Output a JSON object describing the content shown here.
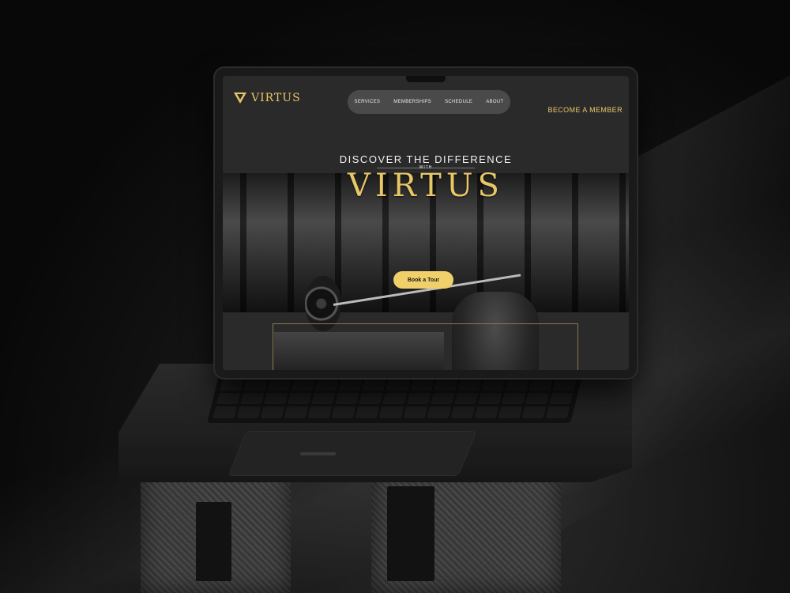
{
  "site": {
    "brand": "VIRTUS",
    "nav": {
      "items": [
        {
          "label": "SERVICES"
        },
        {
          "label": "MEMBERSHIPS"
        },
        {
          "label": "SCHEDULE"
        },
        {
          "label": "ABOUT"
        }
      ]
    },
    "cta_top": "BECOME A MEMBER",
    "hero": {
      "heading": "DISCOVER THE DIFFERENCE",
      "with": "WITH",
      "brand_big": "VIRTUS",
      "button": "Book a Tour"
    }
  },
  "colors": {
    "accent": "#e8c766",
    "button_bg": "#f0d06b",
    "page_bg": "#2a2a2a",
    "nav_pill": "#4a4a4a"
  },
  "icons": {
    "logo": "virtus-logo-icon"
  }
}
